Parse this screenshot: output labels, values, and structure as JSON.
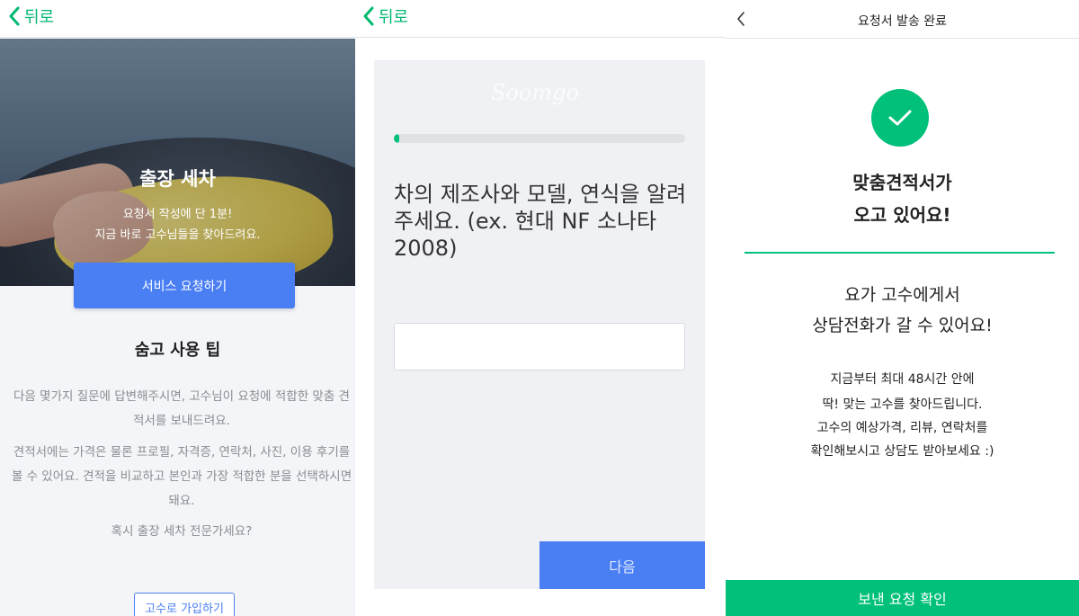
{
  "colors": {
    "brand_green": "#00c07a",
    "primary_blue": "#4a7ff4",
    "gray_text": "#8a8c91"
  },
  "screen1": {
    "back_icon": "chevron-left-icon",
    "back_label": "뒤로",
    "hero_title": "출장 세차",
    "hero_sub_line1": "요청서 작성에 단 1분!",
    "hero_sub_line2": "지금 바로 고수님들을 찾아드려요.",
    "request_button": "서비스 요청하기",
    "tips_title": "숨고 사용 팁",
    "tip1": "다음 몇가지 질문에 답변해주시면, 고수님이 요청에 적합한 맞춤 견적서를 보내드려요.",
    "tip2": "견적서에는 가격은 물론 프로필, 자격증, 연락처, 사진, 이용 후기를 볼 수 있어요. 견적을 비교하고 본인과 가장 적합한 분을 선택하시면 돼요.",
    "tip3": "혹시 출장 세차 전문가세요?",
    "join_button": "고수로 가입하기"
  },
  "screen2": {
    "back_icon": "chevron-left-icon",
    "back_label": "뒤로",
    "brand_watermark": "Soomgo",
    "progress_fraction": 0.02,
    "question": "차의 제조사와 모델, 연식을 알려주세요. (ex. 현대 NF 소나타 2008)",
    "answer_value": "",
    "next_button": "다음"
  },
  "screen3": {
    "back_icon": "chevron-left-icon",
    "title": "요청서 발송 완료",
    "check_icon": "check-icon",
    "headline_line1": "맞춤견적서가",
    "headline_line2": "오고 있어요!",
    "message_line1": "요가 고수에게서",
    "message_line2": "상담전화가 갈 수 있어요!",
    "detail_line1": "지금부터 최대 48시간 안에",
    "detail_line2": "딱! 맞는 고수를 찾아드립니다.",
    "detail_line3": "고수의 예상가격, 리뷰, 연락처를",
    "detail_line4": "확인해보시고 상담도 받아보세요 :)",
    "confirm_button": "보낸 요청 확인"
  }
}
